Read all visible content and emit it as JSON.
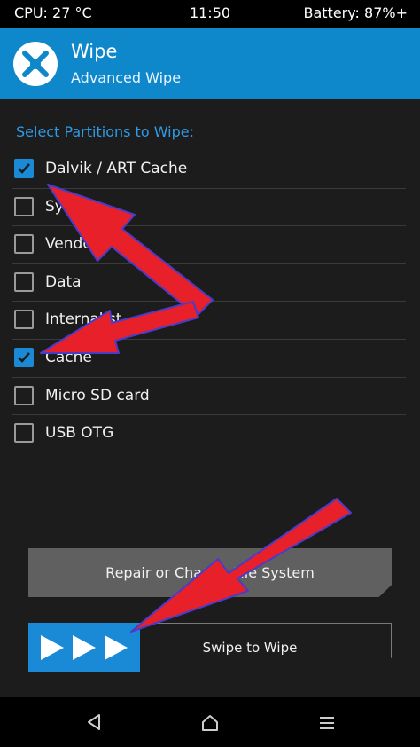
{
  "status_bar": {
    "cpu": "CPU: 27 °C",
    "time": "11:50",
    "battery": "Battery: 87%+"
  },
  "header": {
    "title": "Wipe",
    "subtitle": "Advanced Wipe",
    "logo_icon": "twrp-logo-icon"
  },
  "section_label": "Select Partitions to Wipe:",
  "partitions": [
    {
      "label": "Dalvik / ART Cache",
      "checked": true
    },
    {
      "label": "Sys",
      "checked": false
    },
    {
      "label": "Vendor",
      "checked": false
    },
    {
      "label": "Data",
      "checked": false
    },
    {
      "label": "Internal st",
      "checked": false
    },
    {
      "label": "Cache",
      "checked": true
    },
    {
      "label": "Micro SD card",
      "checked": false
    },
    {
      "label": "USB OTG",
      "checked": false
    }
  ],
  "repair_button": {
    "label": "Repair or Change File System"
  },
  "swipe": {
    "label": "Swipe to Wipe"
  },
  "nav_icons": [
    "back-icon",
    "home-icon",
    "menu-icon"
  ],
  "colors": {
    "accent": "#0f87cb",
    "checkbox": "#1a8ad6",
    "annotation_arrow": "#e8202a",
    "arrow_outline": "#4b3cc8"
  }
}
